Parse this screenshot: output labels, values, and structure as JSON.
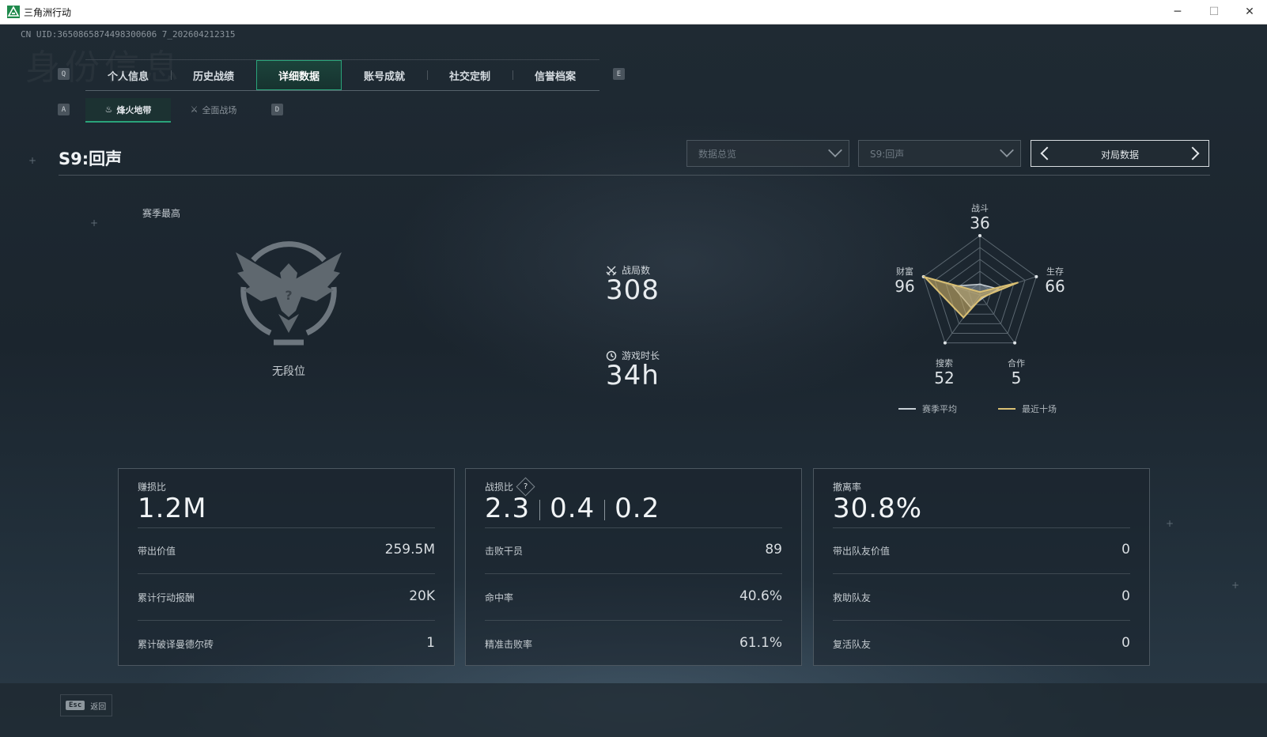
{
  "window": {
    "title": "三角洲行动",
    "minimize": "─",
    "maximize": "☐",
    "close": "✕"
  },
  "uid": "CN UID:3650865874498300606 7_202604212315",
  "background_watermark": "身份信息",
  "tabs": {
    "prev_key": "Q",
    "next_key": "E",
    "items": [
      {
        "label": "个人信息"
      },
      {
        "label": "历史战绩"
      },
      {
        "label": "详细数据",
        "active": true
      },
      {
        "label": "账号成就"
      },
      {
        "label": "社交定制"
      },
      {
        "label": "信誉档案"
      }
    ]
  },
  "subtabs": {
    "prev_key": "A",
    "next_key": "D",
    "items": [
      {
        "label": "烽火地带",
        "active": true
      },
      {
        "label": "全面战场"
      }
    ]
  },
  "season": {
    "title": "S9:回声",
    "dropdown_view": "数据总览",
    "dropdown_season": "S9:回声",
    "pager_label": "对局数据"
  },
  "rank": {
    "season_best_label": "赛季最高",
    "rank_name": "无段位"
  },
  "mid_stats": {
    "matches_label": "战局数",
    "matches_value": "308",
    "playtime_label": "游戏时长",
    "playtime_value": "34h"
  },
  "radar": {
    "axes": [
      {
        "label": "战斗",
        "value": 36
      },
      {
        "label": "生存",
        "value": 66
      },
      {
        "label": "合作",
        "value": 5
      },
      {
        "label": "搜索",
        "value": 52
      },
      {
        "label": "财富",
        "value": 96
      }
    ],
    "legend": [
      {
        "label": "赛季平均",
        "color": "#c8d0d6"
      },
      {
        "label": "最近十场",
        "color": "#d9bf73"
      }
    ],
    "season_avg_fraction": [
      0.18,
      0.33,
      0.07,
      0.26,
      0.48
    ],
    "recent_ten_fraction": [
      0.05,
      0.68,
      0.05,
      0.47,
      0.98
    ],
    "avg_fill": "#8e9aa5",
    "recent_fill": "#c9ad66"
  },
  "cards": [
    {
      "label": "赚损比",
      "big": "1.2M",
      "rows": [
        {
          "k": "带出价值",
          "v": "259.5M"
        },
        {
          "k": "累计行动报酬",
          "v": "20K"
        },
        {
          "k": "累计破译曼德尔砖",
          "v": "1"
        }
      ]
    },
    {
      "label": "战损比",
      "help": "?",
      "big_parts": [
        "2.3",
        "0.4",
        "0.2"
      ],
      "rows": [
        {
          "k": "击败干员",
          "v": "89"
        },
        {
          "k": "命中率",
          "v": "40.6%"
        },
        {
          "k": "精准击败率",
          "v": "61.1%"
        }
      ]
    },
    {
      "label": "撤离率",
      "big": "30.8%",
      "rows": [
        {
          "k": "带出队友价值",
          "v": "0"
        },
        {
          "k": "救助队友",
          "v": "0"
        },
        {
          "k": "复活队友",
          "v": "0"
        }
      ]
    }
  ],
  "footer": {
    "esc_key": "Esc",
    "back_label": "返回"
  },
  "colors": {
    "accent": "#2aa37a",
    "gold": "#d9bf73"
  }
}
